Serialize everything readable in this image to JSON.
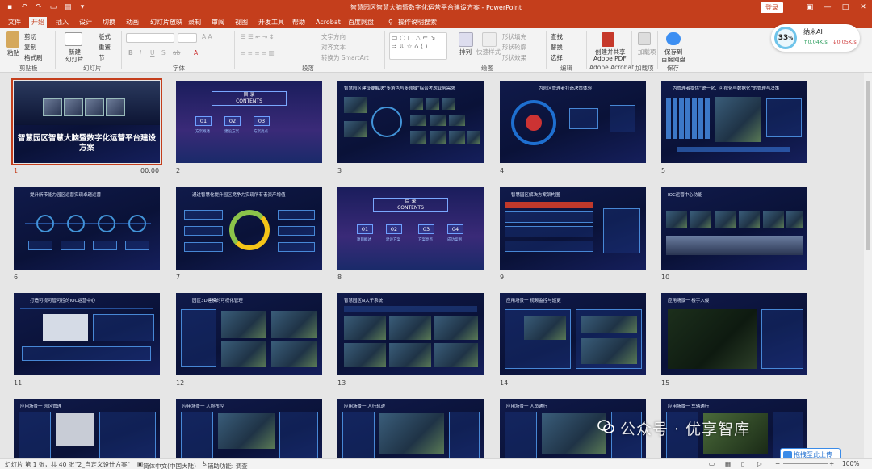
{
  "window": {
    "title": "智慧园区智慧大脑暨数字化运营平台建设方案 - PowerPoint",
    "login_label": "登录"
  },
  "tabs": [
    "文件",
    "开始",
    "插入",
    "设计",
    "切换",
    "动画",
    "幻灯片放映",
    "录制",
    "审阅",
    "视图",
    "开发工具",
    "帮助",
    "Acrobat",
    "百度网盘",
    "操作说明搜索"
  ],
  "ribbon": {
    "clipboard": {
      "paste": "粘贴",
      "cut": "剪切",
      "copy": "复制",
      "format_painter": "格式刷",
      "label": "剪贴板"
    },
    "slides": {
      "new_slide": "新建",
      "new_slide_line2": "幻灯片",
      "layout": "版式",
      "reset": "重置",
      "section": "节",
      "label": "幻灯片"
    },
    "font": {
      "label": "字体"
    },
    "paragraph": {
      "text_direction": "文字方向",
      "align_text": "对齐文本",
      "smartart": "转换为 SmartArt",
      "label": "段落"
    },
    "drawing": {
      "arrange": "排列",
      "quick_styles": "快速样式",
      "shape_fill": "形状填充",
      "shape_outline": "形状轮廓",
      "shape_effects": "形状效果",
      "label": "绘图"
    },
    "editing": {
      "find": "查找",
      "replace": "替换",
      "select": "选择",
      "label": "编辑"
    },
    "acrobat": {
      "create_share": "创建并共享",
      "create_share_line2": "Adobe PDF",
      "label": "Adobe Acrobat"
    },
    "addins": {
      "addins": "加载项",
      "label": "加载项"
    },
    "save": {
      "save_to": "保存到",
      "save_to_line2": "百度网盘",
      "label": "保存"
    }
  },
  "network": {
    "percent": "33",
    "percent_unit": "%",
    "name": "纳米AI",
    "upload": "0.04K/s",
    "download": "0.05K/s"
  },
  "slides": [
    {
      "num": "1",
      "time": "00:00",
      "title": "智慧园区智慧大脑暨数字化运营平台建设方案"
    },
    {
      "num": "2",
      "title": "目 录",
      "subtitle": "CONTENTS",
      "items": [
        "01",
        "02",
        "03"
      ],
      "labels": [
        "方案概述",
        "建设方案",
        "方案亮点"
      ]
    },
    {
      "num": "3",
      "title": "智慧园区建设要解决“多角色与多领域”综合考虑业务需求"
    },
    {
      "num": "4",
      "title": "为园区管理者打造决策体验"
    },
    {
      "num": "5",
      "title": "为管理者提供“统一化、可视化与数据化”的管理与决策"
    },
    {
      "num": "6",
      "title": "提升所带能力园区运营实现卓越运营"
    },
    {
      "num": "7",
      "title": "通过智慧化提升园区竞争力实现所有者资产增值"
    },
    {
      "num": "8",
      "title": "目 录",
      "subtitle": "CONTENTS",
      "items": [
        "01",
        "02",
        "03",
        "04"
      ],
      "labels": [
        "项目概述",
        "建设方案",
        "方案亮点",
        "成功案例"
      ]
    },
    {
      "num": "9",
      "title": "智慧园区解决方案架构图"
    },
    {
      "num": "10",
      "title": "IOC运营中心功能"
    },
    {
      "num": "11",
      "title": "打造可视可管可控的IOC运营中心"
    },
    {
      "num": "12",
      "title": "园区3D建模的可视化管理"
    },
    {
      "num": "13",
      "title": "智慧园区N大子系统"
    },
    {
      "num": "14",
      "title": "应用场景一 视频监控与巡更"
    },
    {
      "num": "15",
      "title": "应用场景一 楼宇入侵"
    },
    {
      "num": "16",
      "title": "应用场景一 园区管理"
    },
    {
      "num": "17",
      "title": "应用场景一 人脸布控"
    },
    {
      "num": "18",
      "title": "应用场景一 人行轨迹"
    },
    {
      "num": "19",
      "title": "应用场景一 人员通行"
    },
    {
      "num": "20",
      "title": "应用场景一 车辆通行"
    }
  ],
  "status": {
    "slide_info": "幻灯片 第 1 张，共 40 张",
    "theme": "\"2_自定义设计方案\"",
    "language": "简体中文(中国大陆)",
    "accessibility": "辅助功能: 调查",
    "zoom": "100%"
  },
  "watermark": {
    "text": "公众号 · 优享智库",
    "upload_button": "拖拽至此上传"
  }
}
